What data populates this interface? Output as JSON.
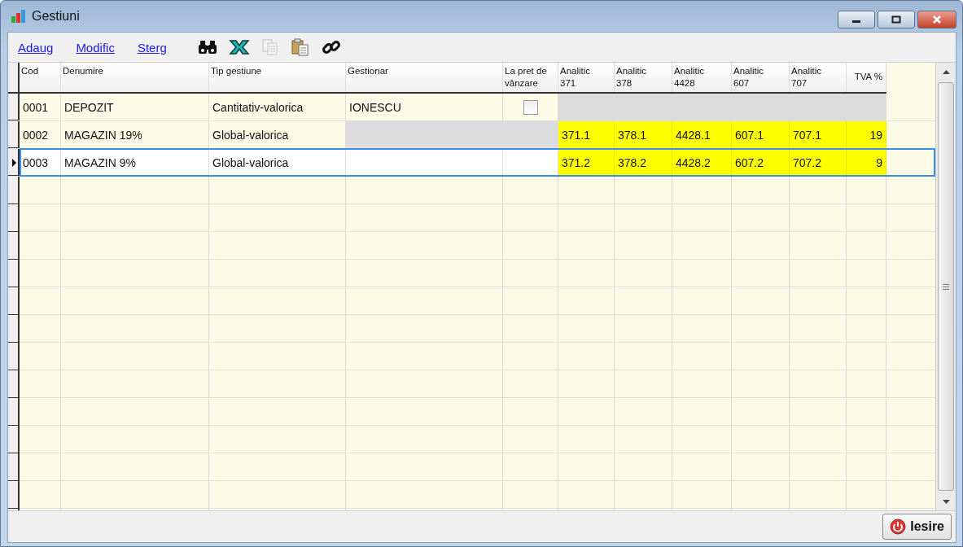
{
  "window": {
    "title": "Gestiuni"
  },
  "toolbar": {
    "links": [
      {
        "label": "Adaug"
      },
      {
        "label": "Modific"
      },
      {
        "label": "Sterg"
      }
    ],
    "icons": [
      {
        "kind": "binoculars",
        "disabled": false
      },
      {
        "kind": "excel",
        "disabled": false
      },
      {
        "kind": "copy",
        "disabled": true
      },
      {
        "kind": "paste",
        "disabled": false
      },
      {
        "kind": "link",
        "disabled": false
      }
    ]
  },
  "table": {
    "columns": [
      {
        "label": "Cod"
      },
      {
        "label": "Denumire"
      },
      {
        "label": "Tip gestiune"
      },
      {
        "label": "Gestionar"
      },
      {
        "label": "La pret de vânzare"
      },
      {
        "label": "Analitic 371"
      },
      {
        "label": "Analitic 378"
      },
      {
        "label": "Analitic 4428"
      },
      {
        "label": "Analitic 607"
      },
      {
        "label": "Analitic 707"
      },
      {
        "label": "TVA %"
      }
    ],
    "rows": [
      {
        "selected": false,
        "cells": [
          {
            "kind": "text",
            "text": "0001",
            "disabled": false,
            "highlighted": false
          },
          {
            "kind": "text",
            "text": "DEPOZIT",
            "disabled": false,
            "highlighted": false
          },
          {
            "kind": "text",
            "text": "Cantitativ-valorica",
            "disabled": false,
            "highlighted": false
          },
          {
            "kind": "text",
            "text": "IONESCU",
            "disabled": false,
            "highlighted": false
          },
          {
            "kind": "checkbox",
            "checked": false,
            "disabled": false,
            "highlighted": false
          },
          {
            "kind": "text",
            "disabled": true,
            "highlighted": false
          },
          {
            "kind": "text",
            "disabled": true,
            "highlighted": false
          },
          {
            "kind": "text",
            "disabled": true,
            "highlighted": false
          },
          {
            "kind": "text",
            "disabled": true,
            "highlighted": false
          },
          {
            "kind": "text",
            "disabled": true,
            "highlighted": false
          },
          {
            "kind": "text",
            "disabled": true,
            "highlighted": false
          }
        ]
      },
      {
        "selected": false,
        "cells": [
          {
            "kind": "text",
            "text": "0002",
            "disabled": false,
            "highlighted": false
          },
          {
            "kind": "text",
            "text": "MAGAZIN 19%",
            "disabled": false,
            "highlighted": false
          },
          {
            "kind": "text",
            "text": "Global-valorica",
            "disabled": false,
            "highlighted": false
          },
          {
            "kind": "text",
            "disabled": true,
            "highlighted": false
          },
          {
            "kind": "text",
            "disabled": true,
            "highlighted": false
          },
          {
            "kind": "text",
            "text": "371.1",
            "disabled": false,
            "highlighted": true
          },
          {
            "kind": "text",
            "text": "378.1",
            "disabled": false,
            "highlighted": true
          },
          {
            "kind": "text",
            "text": "4428.1",
            "disabled": false,
            "highlighted": true
          },
          {
            "kind": "text",
            "text": "607.1",
            "disabled": false,
            "highlighted": true
          },
          {
            "kind": "text",
            "text": "707.1",
            "disabled": false,
            "highlighted": true
          },
          {
            "kind": "text",
            "text": "19",
            "disabled": false,
            "highlighted": true
          }
        ]
      },
      {
        "selected": true,
        "cells": [
          {
            "kind": "text",
            "text": "0003",
            "disabled": false,
            "highlighted": false
          },
          {
            "kind": "text",
            "text": "MAGAZIN 9%",
            "disabled": false,
            "highlighted": false
          },
          {
            "kind": "text",
            "text": "Global-valorica",
            "disabled": false,
            "highlighted": false
          },
          {
            "kind": "text",
            "disabled": false,
            "highlighted": false
          },
          {
            "kind": "text",
            "disabled": false,
            "highlighted": false
          },
          {
            "kind": "text",
            "text": "371.2",
            "disabled": false,
            "highlighted": true
          },
          {
            "kind": "text",
            "text": "378.2",
            "disabled": false,
            "highlighted": true
          },
          {
            "kind": "text",
            "text": "4428.2",
            "disabled": false,
            "highlighted": true
          },
          {
            "kind": "text",
            "text": "607.2",
            "disabled": false,
            "highlighted": true
          },
          {
            "kind": "text",
            "text": "707.2",
            "disabled": false,
            "highlighted": true
          },
          {
            "kind": "text",
            "text": "9",
            "disabled": false,
            "highlighted": true
          }
        ]
      }
    ]
  },
  "buttons": [
    {
      "label": "Iesire"
    }
  ]
}
